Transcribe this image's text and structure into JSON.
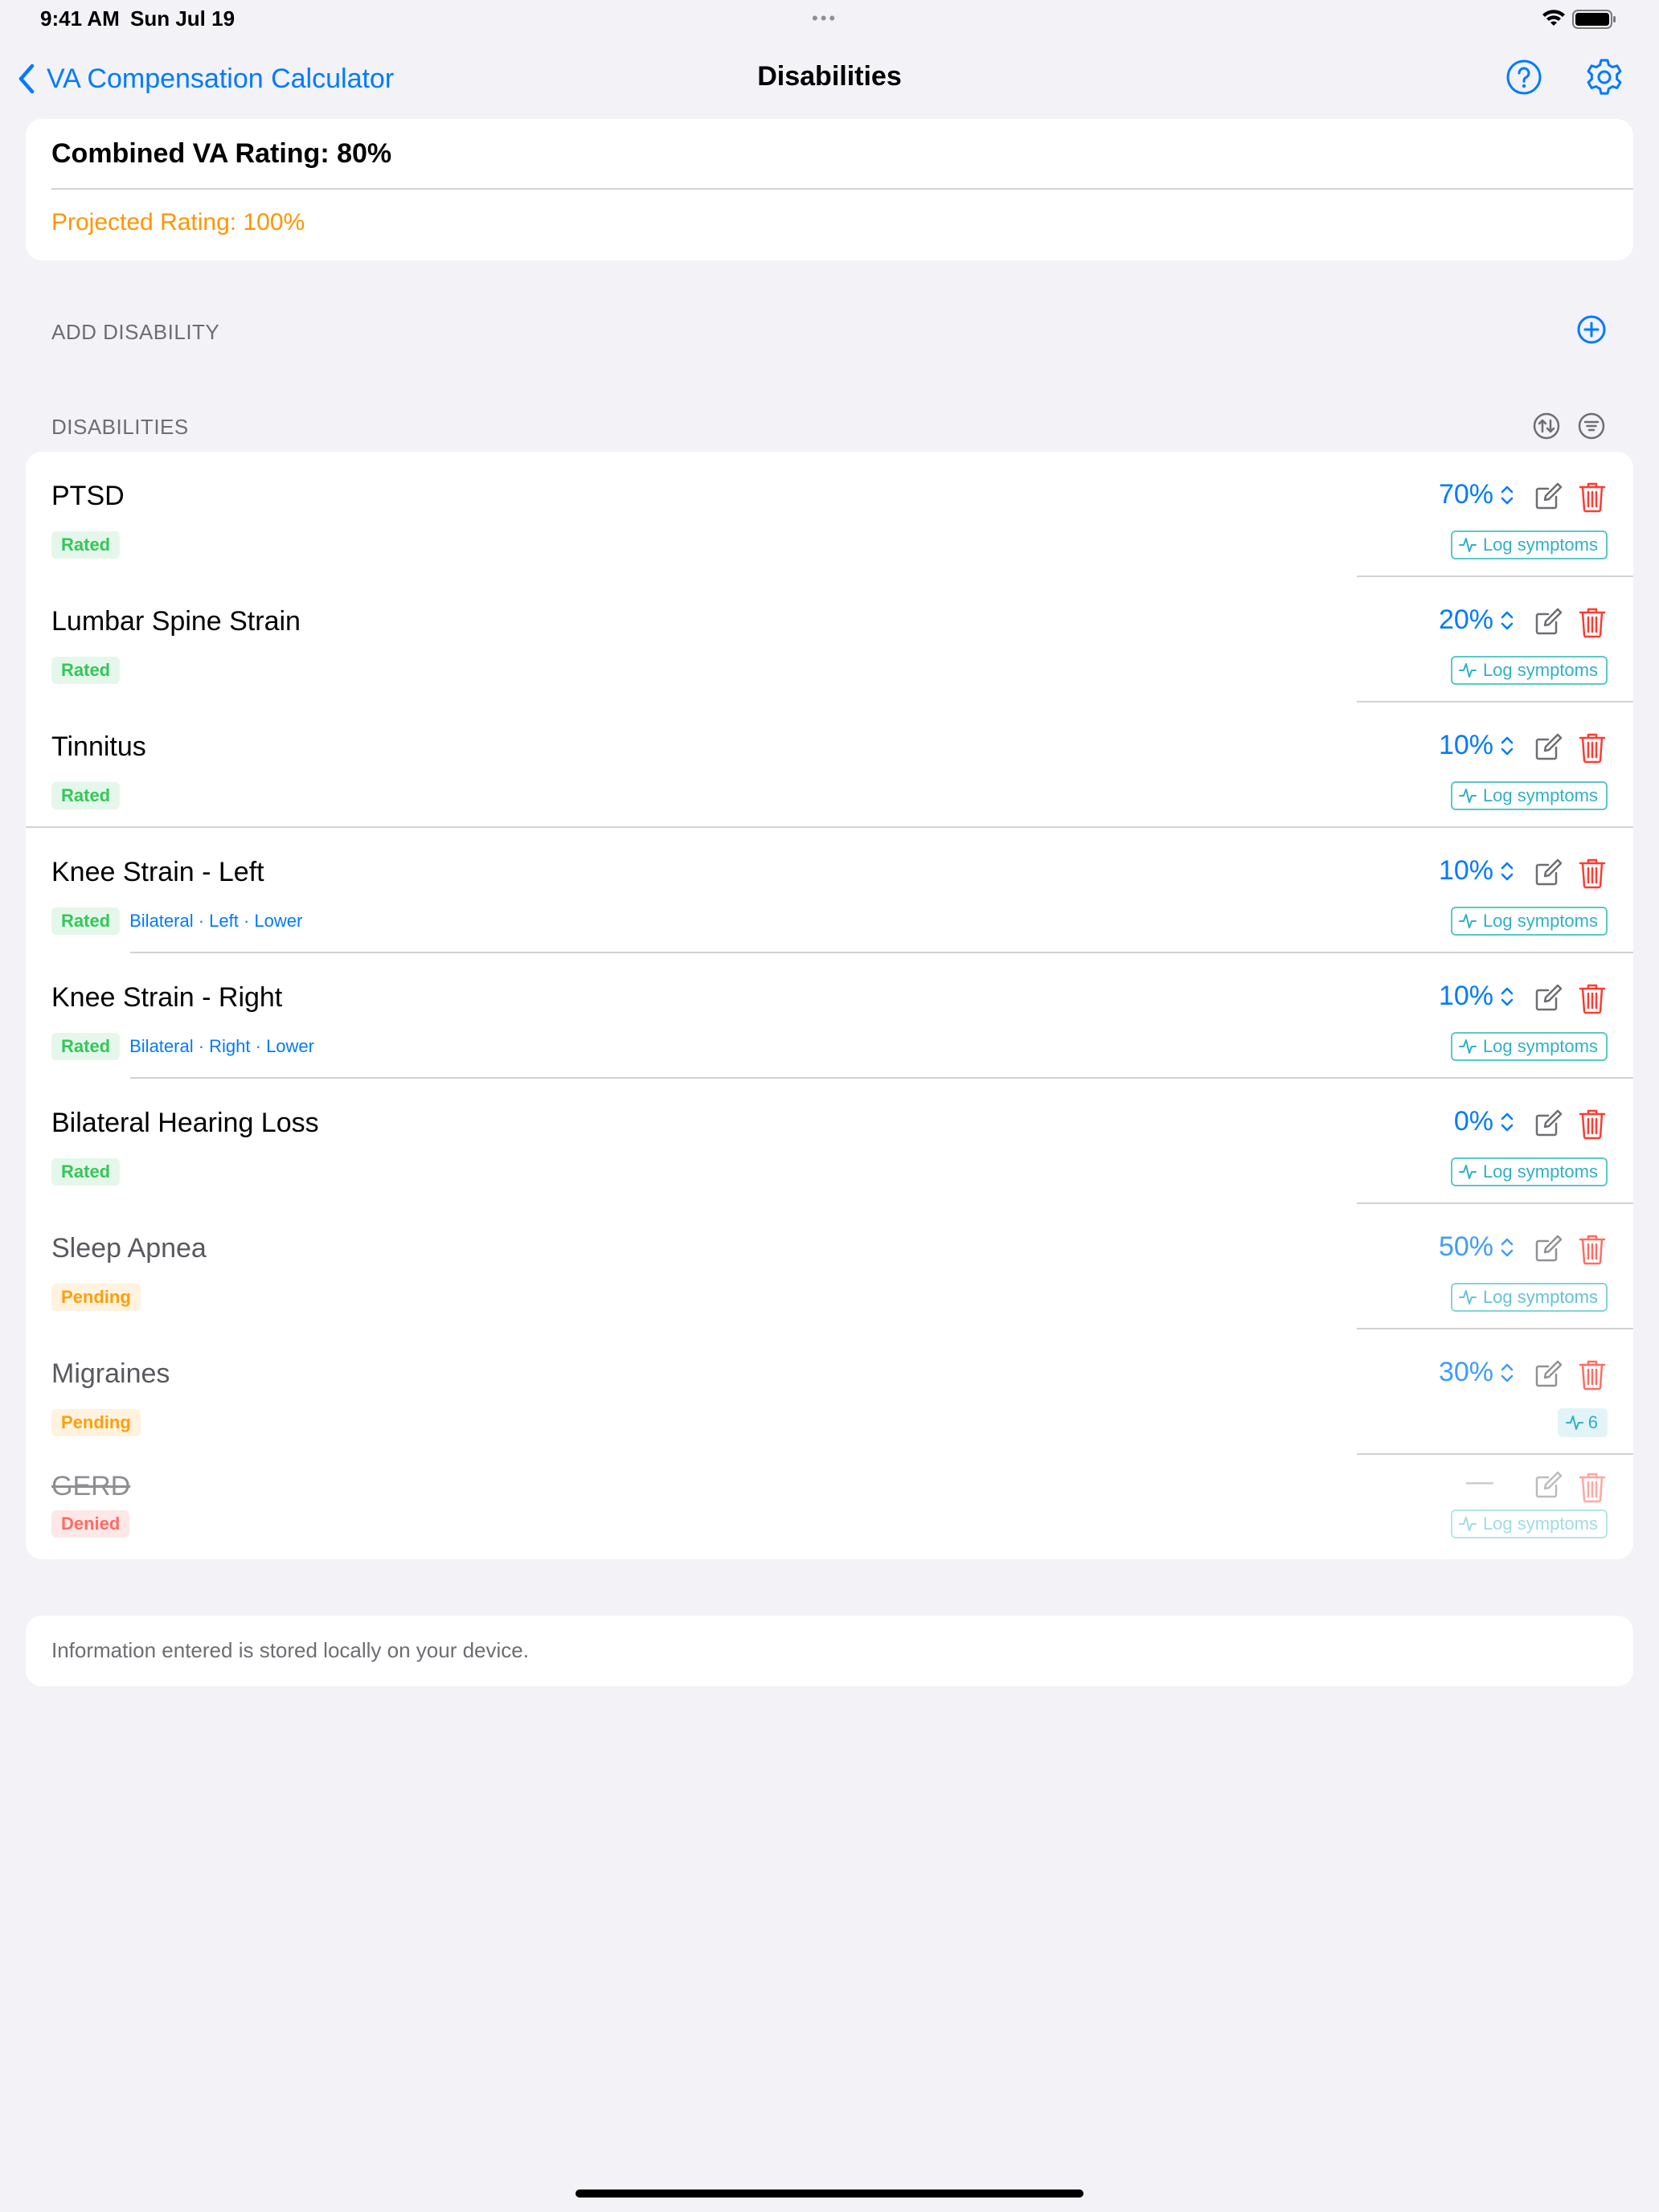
{
  "status_bar": {
    "time": "9:41 AM",
    "date": "Sun Jul 19"
  },
  "nav": {
    "back_label": "VA Compensation Calculator",
    "title": "Disabilities"
  },
  "summary": {
    "combined": "Combined VA Rating: 80%",
    "projected": "Projected Rating: 100%"
  },
  "sections": {
    "add": "ADD DISABILITY",
    "disabilities": "DISABILITIES"
  },
  "log_label": "Log symptoms",
  "disabilities": [
    {
      "name": "PTSD",
      "status": "Rated",
      "percent": "70%",
      "tags": ""
    },
    {
      "name": "Lumbar Spine Strain",
      "status": "Rated",
      "percent": "20%",
      "tags": ""
    },
    {
      "name": "Tinnitus",
      "status": "Rated",
      "percent": "10%",
      "tags": ""
    },
    {
      "name": "Knee Strain - Left",
      "status": "Rated",
      "percent": "10%",
      "tags": "Bilateral · Left · Lower"
    },
    {
      "name": "Knee Strain - Right",
      "status": "Rated",
      "percent": "10%",
      "tags": "Bilateral · Right · Lower"
    },
    {
      "name": "Bilateral Hearing Loss",
      "status": "Rated",
      "percent": "0%",
      "tags": ""
    },
    {
      "name": "Sleep Apnea",
      "status": "Pending",
      "percent": "50%",
      "tags": ""
    },
    {
      "name": "Migraines",
      "status": "Pending",
      "percent": "30%",
      "tags": "",
      "log_count": "6"
    },
    {
      "name": "GERD",
      "status": "Denied",
      "percent": "—",
      "tags": ""
    }
  ],
  "footer": "Information entered is stored locally on your device.",
  "colors": {
    "accent": "#007aff",
    "rated": "#34c759",
    "pending": "#ff9f0a",
    "denied": "#ff3b30",
    "projected": "#ff9500",
    "log": "#30b0c7"
  }
}
